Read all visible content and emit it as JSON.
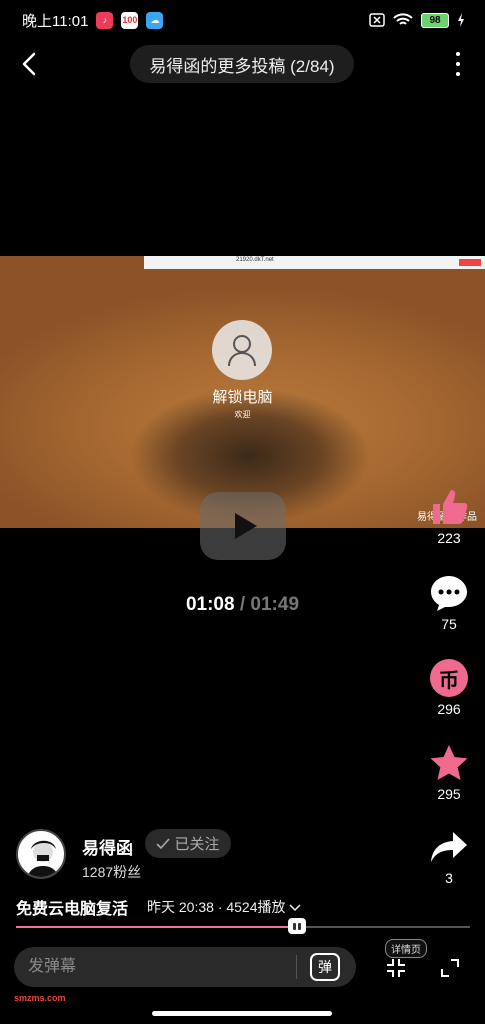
{
  "status": {
    "time": "晚上11:01",
    "app2": "100",
    "battery": "98"
  },
  "header": {
    "title": "易得函的更多投稿 (2/84)"
  },
  "video": {
    "url_text": "21920.dkT.net",
    "lock_title": "解锁电脑",
    "lock_sub": "欢迎",
    "watermark": "易得函的作品"
  },
  "playback": {
    "current": "01:08",
    "separator": "/",
    "total": "01:49",
    "progress": 0.62
  },
  "actions": {
    "like_count": "223",
    "comment_count": "75",
    "coin_label": "币",
    "coin_count": "296",
    "fav_count": "295",
    "share_count": "3"
  },
  "uploader": {
    "name": "易得函",
    "follow_label": "已关注",
    "fans": "1287粉丝"
  },
  "info": {
    "title": "免费云电脑复活",
    "meta": "昨天 20:38 · 4524播放"
  },
  "bottom": {
    "danmaku_placeholder": "发弹幕",
    "danmaku_btn": "弹",
    "detail_tag": "详情页",
    "site": "smzms.com"
  },
  "colors": {
    "accent": "#f07298",
    "like": "#ef6a8e"
  }
}
